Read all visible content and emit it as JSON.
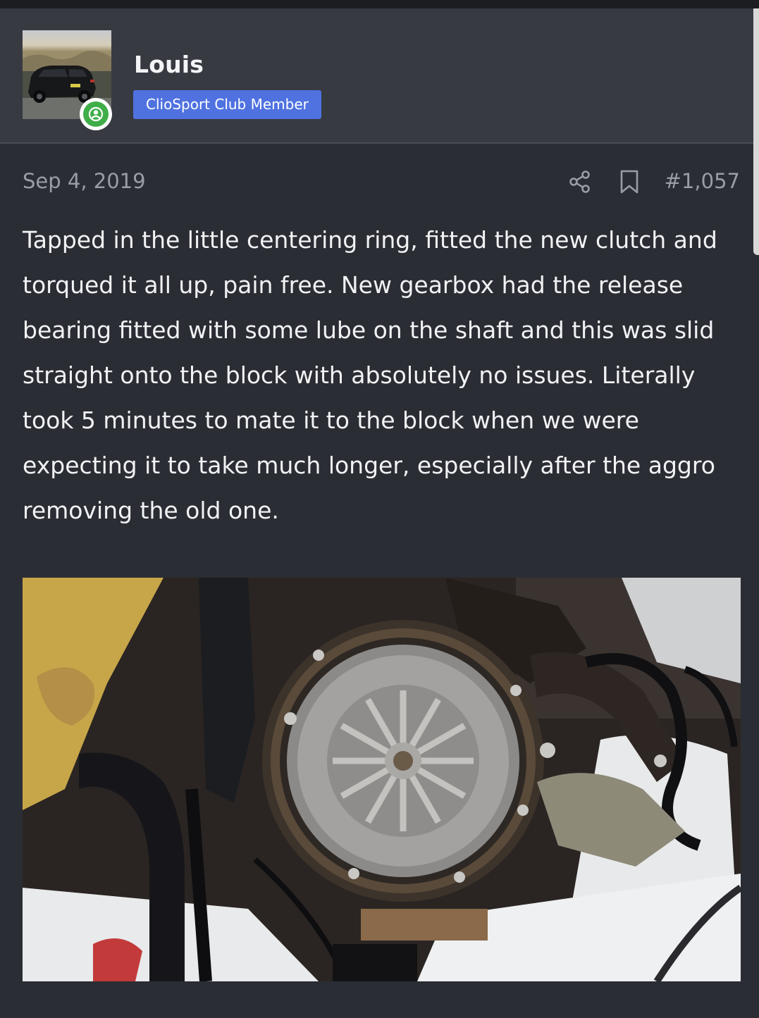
{
  "user": {
    "name": "Louis",
    "badge": "ClioSport Club Member",
    "status": "online"
  },
  "post": {
    "date": "Sep 4, 2019",
    "number": "#1,057",
    "body": "Tapped in the little centering ring, fitted the new clutch and torqued it all up, pain free. New gearbox had the release bearing fitted with some lube on the shaft and this was slid straight onto the block with absolutely no issues. Literally took 5 minutes to mate it to the block when we were expecting it to take much longer, especially after the aggro removing the old one."
  },
  "icons": {
    "share": "share-icon",
    "bookmark": "bookmark-icon",
    "online": "user-online-icon"
  },
  "colors": {
    "background": "#2b2d34",
    "header": "#383a42",
    "badge": "#4f72e0",
    "online": "#3fae49",
    "muted_text": "#9a9da6"
  }
}
